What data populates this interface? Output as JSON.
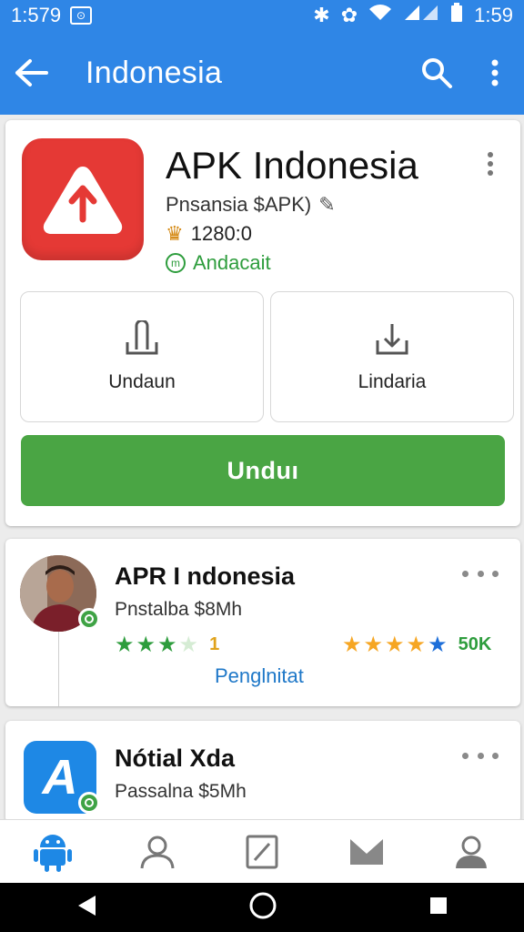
{
  "status_bar": {
    "left_time": "1:579",
    "right_time": "1:59"
  },
  "app_bar": {
    "title": "Indonesia"
  },
  "app_card": {
    "title": "APK Indonesia",
    "subtitle": "Pnsansia $APK)",
    "downloads": "1280:0",
    "status": "Andacait",
    "tile_left_label": "Undaun",
    "tile_right_label": "Lindaria",
    "primary_button_label": "Unduı"
  },
  "list_items": [
    {
      "title": "APR I ndonesia",
      "subtitle": "Pnstalba $8Mh",
      "rating_left": {
        "filled": 3,
        "empty": 1,
        "count": "1"
      },
      "rating_right": {
        "filled": 4,
        "count": "50K"
      },
      "link": "Penglnitat"
    },
    {
      "title": "Nótial Xda",
      "subtitle": "Passalna $5Mh"
    }
  ],
  "colors": {
    "primary_blue": "#2f86e6",
    "app_red": "#e53935",
    "button_green": "#4aa544",
    "status_green": "#2e9d3d",
    "link_blue": "#1f78c8",
    "star_orange": "#f6a623"
  },
  "icons": {
    "app_bar": [
      "arrow-left-icon",
      "search-icon",
      "more-vertical-icon"
    ],
    "bottom_nav": [
      "android-icon",
      "person-icon",
      "edit-icon",
      "mail-icon",
      "account-icon"
    ],
    "system_nav": [
      "back-icon",
      "home-icon",
      "recents-icon"
    ]
  }
}
